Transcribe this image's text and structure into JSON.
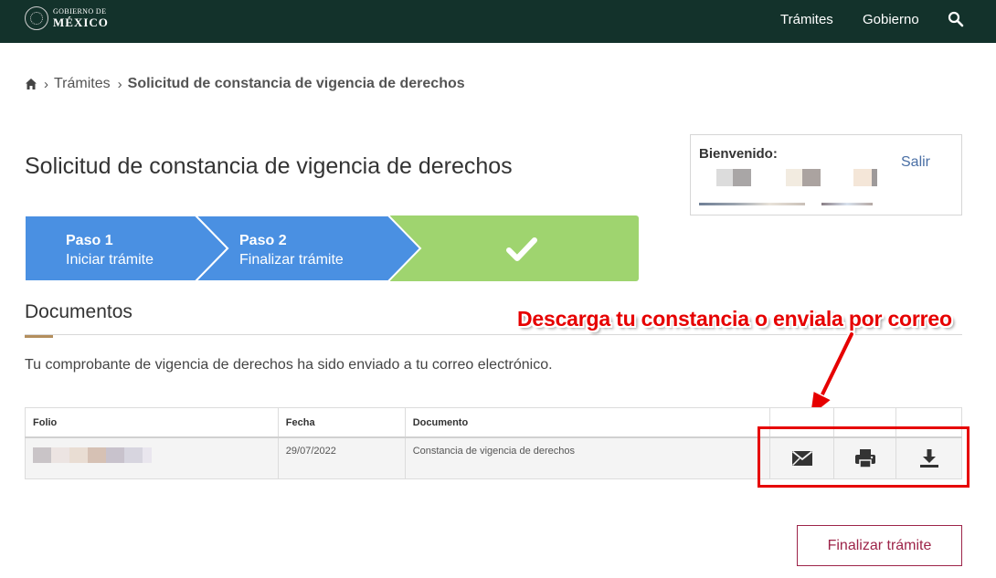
{
  "header": {
    "logo_line1": "GOBIERNO DE",
    "logo_line2": "MÉXICO",
    "nav": [
      "Trámites",
      "Gobierno"
    ],
    "search_icon": "search-icon",
    "background": "#13322b"
  },
  "breadcrumb": {
    "home_icon": "home-icon",
    "items": [
      "Trámites",
      "Solicitud de constancia de vigencia de derechos"
    ]
  },
  "title": "Solicitud de constancia de vigencia de derechos",
  "welcome": {
    "label": "Bienvenido:",
    "logout": "Salir"
  },
  "stepper": {
    "steps": [
      {
        "title": "Paso 1",
        "subtitle": "Iniciar trámite"
      },
      {
        "title": "Paso 2",
        "subtitle": "Finalizar trámite"
      }
    ],
    "done_icon": "check-icon",
    "colors": {
      "step": "#4a90e2",
      "done": "#9fd46f"
    }
  },
  "documents": {
    "title": "Documentos",
    "message": "Tu comprobante de vigencia de derechos ha sido enviado a tu correo electrónico.",
    "table": {
      "headers": [
        "Folio",
        "Fecha",
        "Documento"
      ],
      "rows": [
        {
          "folio": "",
          "fecha": "29/07/2022",
          "documento": "Constancia de vigencia de derechos"
        }
      ],
      "actions": [
        "mail-icon",
        "print-icon",
        "download-icon"
      ]
    }
  },
  "annotation": {
    "text": "Descarga tu constancia o enviala por correo",
    "color": "#e60000"
  },
  "finish_button": "Finalizar trámite",
  "accent_color": "#9d2449"
}
